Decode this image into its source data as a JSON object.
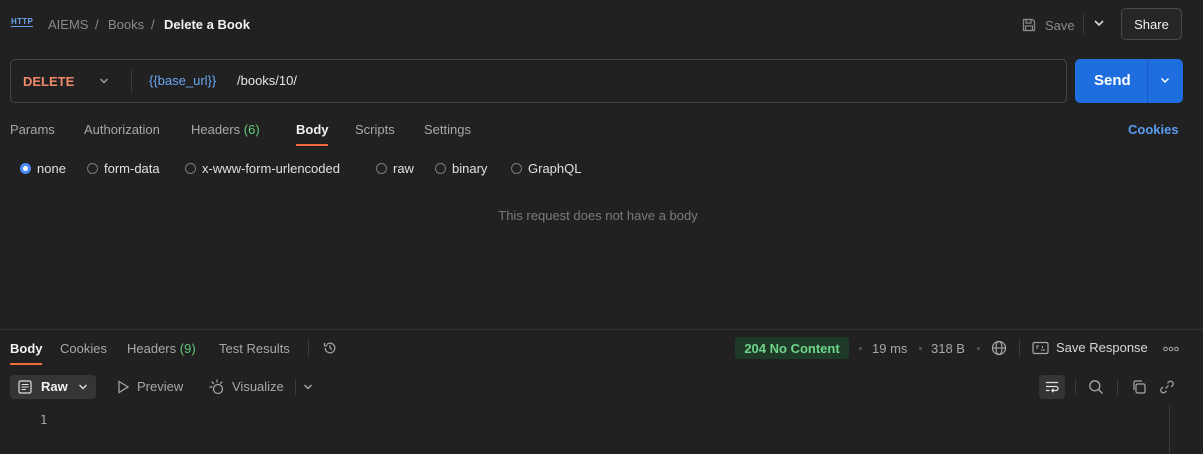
{
  "colors": {
    "background": "#212121",
    "accent_orange": "#f26b3a",
    "method_delete": "#f0896a",
    "send_button": "#1f6ee0",
    "url_variable": "#6aa8f5",
    "status_ok": "#6fd58a",
    "count_green": "#5ecb7a",
    "link_blue": "#5b9cf0"
  },
  "header": {
    "icon": "http-icon",
    "icon_text": "HTTP",
    "breadcrumb": [
      "AIEMS",
      "Books"
    ],
    "separator": "/",
    "title": "Delete a Book",
    "save_label": "Save",
    "share_label": "Share"
  },
  "request": {
    "method": "DELETE",
    "url_variable": "{{base_url}}",
    "url_path": " /books/10/",
    "send_label": "Send"
  },
  "request_tabs": [
    {
      "label": "Params"
    },
    {
      "label": "Authorization"
    },
    {
      "label": "Headers",
      "count": "(6)"
    },
    {
      "label": "Body",
      "active": true
    },
    {
      "label": "Scripts"
    },
    {
      "label": "Settings"
    }
  ],
  "cookies_label": "Cookies",
  "body_types": [
    {
      "label": "none",
      "selected": true
    },
    {
      "label": "form-data"
    },
    {
      "label": "x-www-form-urlencoded"
    },
    {
      "label": "raw"
    },
    {
      "label": "binary"
    },
    {
      "label": "GraphQL"
    }
  ],
  "empty_body_message": "This request does not have a body",
  "response": {
    "tabs": [
      {
        "label": "Body",
        "active": true
      },
      {
        "label": "Cookies"
      },
      {
        "label": "Headers",
        "count": "(9)"
      },
      {
        "label": "Test Results"
      }
    ],
    "status": "204 No Content",
    "time": "19 ms",
    "size": "318 B",
    "save_response_label": "Save Response",
    "format_label": "Raw",
    "preview_label": "Preview",
    "visualize_label": "Visualize",
    "line_number": "1"
  }
}
